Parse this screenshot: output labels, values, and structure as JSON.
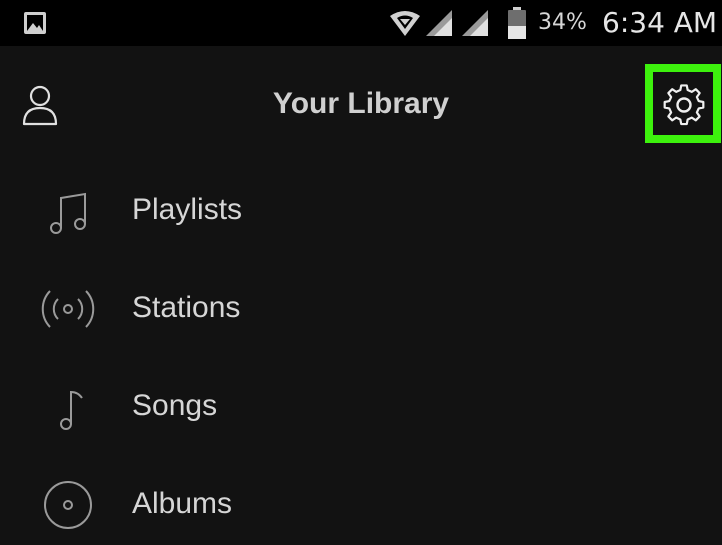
{
  "status_bar": {
    "battery": "34%",
    "time": "6:34 AM",
    "icons": [
      "gallery-icon",
      "wifi-icon",
      "signal-icon",
      "signal-icon",
      "battery-icon"
    ]
  },
  "header": {
    "title": "Your Library",
    "profile_icon": "person-icon",
    "settings_icon": "gear-icon",
    "highlight_color": "#3df20d"
  },
  "library": {
    "items": [
      {
        "label": "Playlists",
        "icon": "music-notes-icon"
      },
      {
        "label": "Stations",
        "icon": "radio-waves-icon"
      },
      {
        "label": "Songs",
        "icon": "music-note-icon"
      },
      {
        "label": "Albums",
        "icon": "album-disc-icon"
      }
    ]
  },
  "colors": {
    "background": "#121212",
    "status_bar": "#000000",
    "text": "#d6d6d6"
  }
}
